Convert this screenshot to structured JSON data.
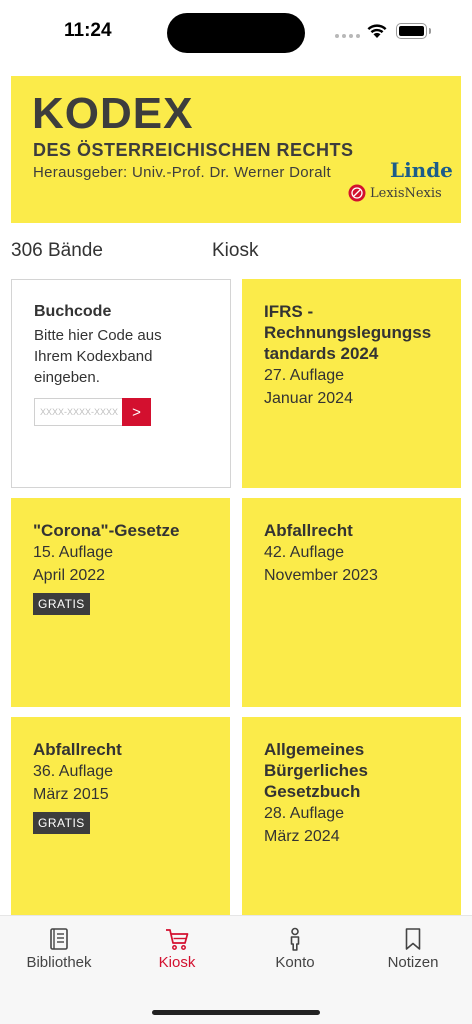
{
  "status": {
    "time": "11:24"
  },
  "banner": {
    "title": "KODEX",
    "subtitle": "DES ÖSTERREICHISCHEN RECHTS",
    "editor": "Herausgeber: Univ.-Prof. Dr. Werner Doralt",
    "publisher1": "Linde",
    "publisher2": "LexisNexis"
  },
  "section": {
    "count_label": "306 Bände",
    "kiosk_label": "Kiosk"
  },
  "code_tile": {
    "title": "Buchcode",
    "text": "Bitte hier Code aus Ihrem Kodexband eingeben.",
    "placeholder": "XXXX-XXXX-XXXX",
    "button": ">"
  },
  "tiles": [
    {
      "title": "IFRS - Rechnungslegungss tandards 2024",
      "edition": "27. Auflage",
      "date": "Januar 2024"
    },
    {
      "title": "\"Corona\"-Gesetze",
      "edition": "15. Auflage",
      "date": "April 2022",
      "badge": "GRATIS"
    },
    {
      "title": "Abfallrecht",
      "edition": "42. Auflage",
      "date": "November 2023"
    },
    {
      "title": "Abfallrecht",
      "edition": "36. Auflage",
      "date": "März 2015",
      "badge": "GRATIS"
    },
    {
      "title": "Allgemeines Bürgerliches Gesetzbuch",
      "edition": "28. Auflage",
      "date": "März 2024"
    }
  ],
  "tabbar": {
    "items": [
      {
        "label": "Bibliothek",
        "icon": "book-icon"
      },
      {
        "label": "Kiosk",
        "icon": "cart-icon",
        "active": true
      },
      {
        "label": "Konto",
        "icon": "person-icon"
      },
      {
        "label": "Notizen",
        "icon": "bookmark-icon"
      }
    ]
  },
  "colors": {
    "accent": "#d3102f",
    "tile": "#fbeb4a",
    "badge": "#3d3d3d"
  }
}
